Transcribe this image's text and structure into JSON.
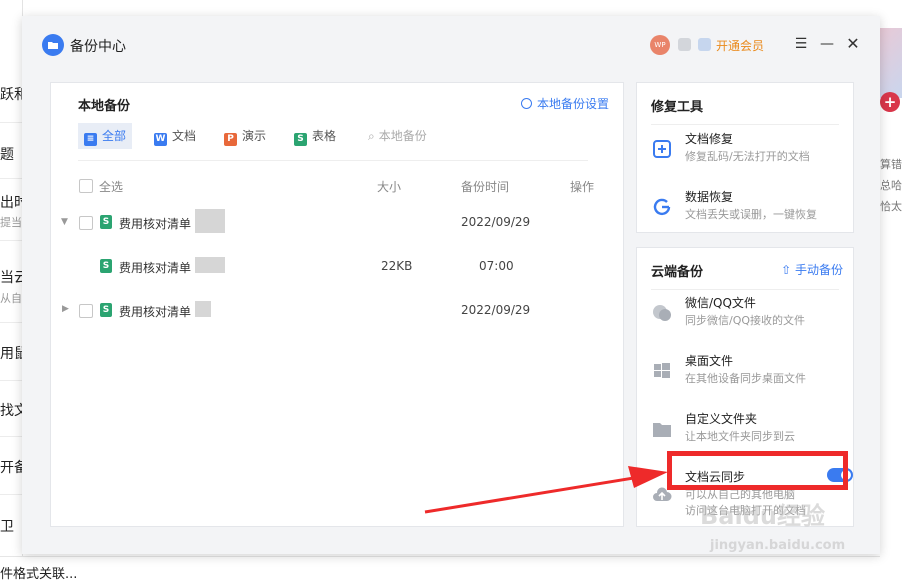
{
  "background": {
    "left_fragments": [
      "跃和",
      "题",
      "出时",
      "提当前",
      "当云",
      "从自",
      "用鼠",
      "找文",
      "开备",
      "卫"
    ],
    "right_fragments": [
      "算错",
      "总哈",
      "恰太"
    ],
    "bottom_text": "件格式关联..."
  },
  "titlebar": {
    "title": "备份中心",
    "avatar_text": "WP",
    "vip_label": "开通会员"
  },
  "local_backup": {
    "title": "本地备份",
    "settings_label": "本地备份设置",
    "tabs": [
      {
        "label": "全部",
        "icon": "list-icon",
        "color": "#3a7bf0"
      },
      {
        "label": "文档",
        "icon": "doc-icon",
        "color": "#3a7bf0"
      },
      {
        "label": "演示",
        "icon": "ppt-icon",
        "color": "#e8683a"
      },
      {
        "label": "表格",
        "icon": "sheet-icon",
        "color": "#2ba471"
      }
    ],
    "search_placeholder": "本地备份",
    "columns": {
      "select_all": "全选",
      "size": "大小",
      "time": "备份时间",
      "action": "操作"
    },
    "rows": [
      {
        "name": "费用核对清单",
        "size": "",
        "time": "2022/09/29",
        "expanded": true
      },
      {
        "name": "费用核对清单",
        "size": "22KB",
        "time": "07:00",
        "child": true
      },
      {
        "name": "费用核对清单",
        "size": "",
        "time": "2022/09/29",
        "expanded": false
      }
    ]
  },
  "repair_tools": {
    "title": "修复工具",
    "items": [
      {
        "title": "文档修复",
        "desc": "修复乱码/无法打开的文档"
      },
      {
        "title": "数据恢复",
        "desc": "文档丢失或误删，一键恢复"
      }
    ]
  },
  "cloud_backup": {
    "title": "云端备份",
    "manual_label": "手动备份",
    "items": [
      {
        "title": "微信/QQ文件",
        "desc": "同步微信/QQ接收的文件"
      },
      {
        "title": "桌面文件",
        "desc": "在其他设备同步桌面文件"
      },
      {
        "title": "自定义文件夹",
        "desc": "让本地文件夹同步到云"
      },
      {
        "title": "文档云同步",
        "desc": "可以从自己的其他电脑",
        "desc2": "访问这台电脑打开的文档",
        "toggle_on": true
      }
    ]
  },
  "watermark": {
    "logo": "Baidu经验",
    "url": "jingyan.baidu.com"
  }
}
